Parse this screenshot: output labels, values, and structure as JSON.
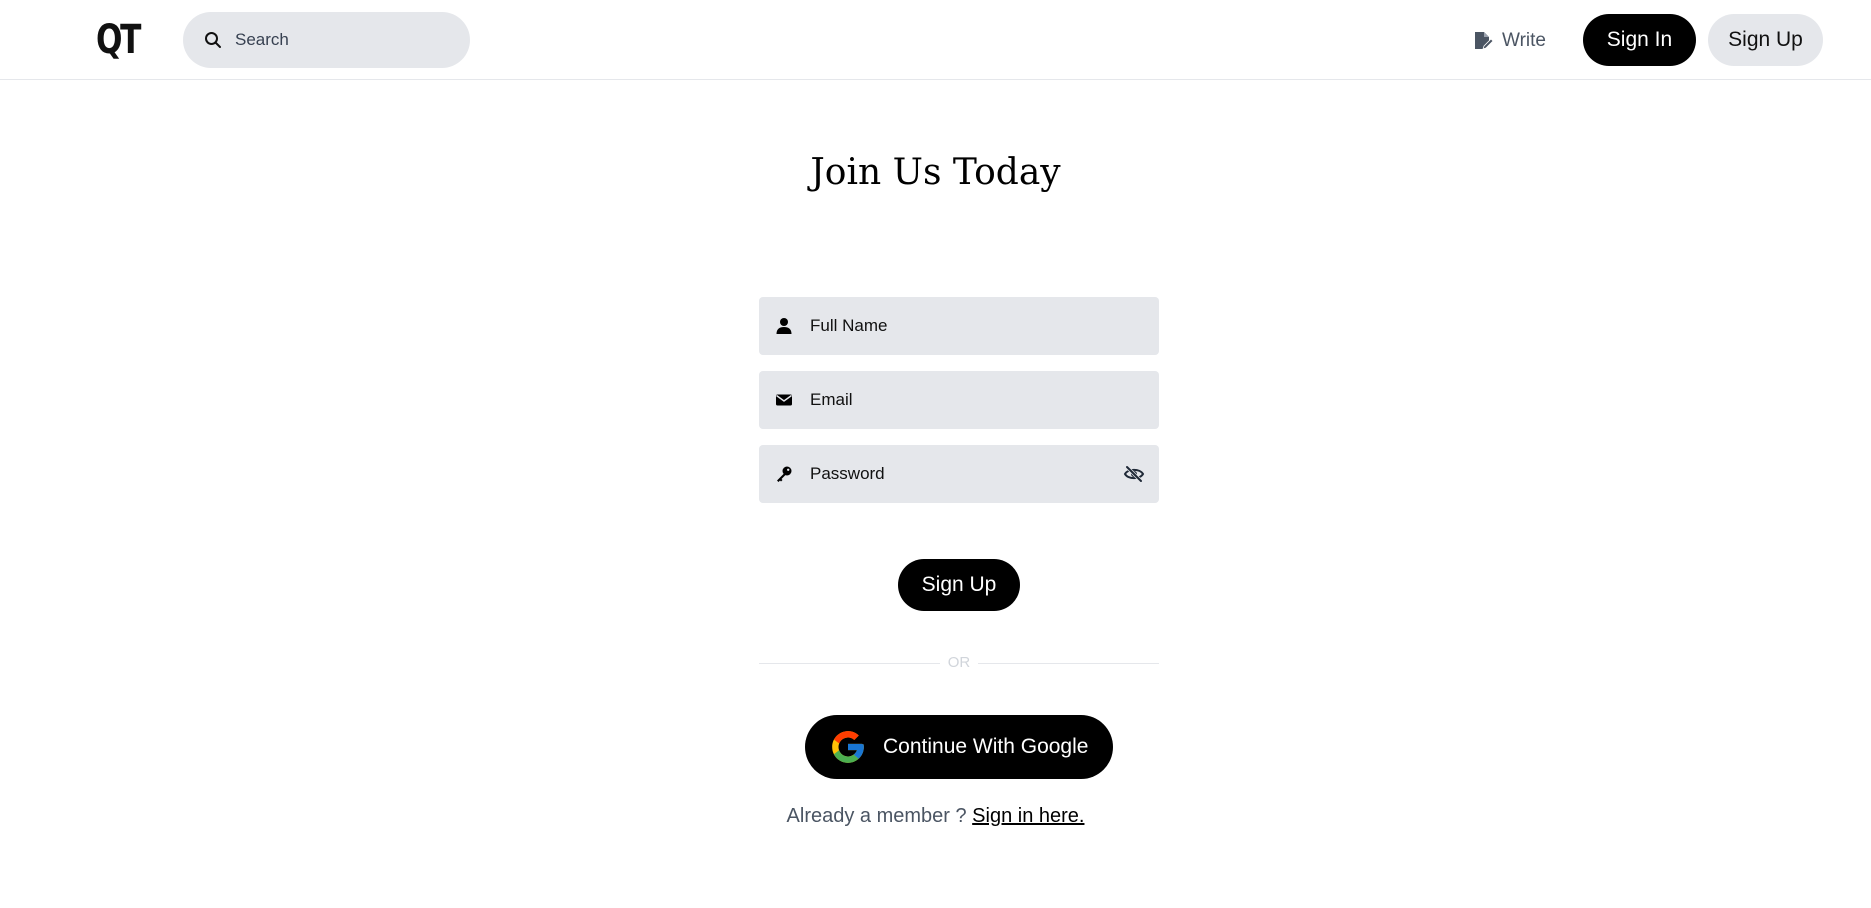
{
  "header": {
    "logo": "QT",
    "search_placeholder": "Search",
    "write_label": "Write",
    "sign_in_label": "Sign In",
    "sign_up_label": "Sign Up"
  },
  "form": {
    "title": "Join Us Today",
    "full_name_placeholder": "Full Name",
    "email_placeholder": "Email",
    "password_placeholder": "Password",
    "submit_label": "Sign Up",
    "divider_text": "OR",
    "google_label": "Continue With Google",
    "member_prompt": "Already a member ?",
    "sign_in_link": "Sign in here."
  },
  "icons": {
    "search": "search-icon",
    "write": "edit-document-icon",
    "full_name": "user-icon",
    "email": "envelope-icon",
    "password": "key-icon",
    "toggle_password": "eye-slash-icon",
    "google": "google-logo-icon"
  },
  "colors": {
    "primary": "#000000",
    "input_bg": "#e5e7eb",
    "muted_text": "#4b5563",
    "divider": "#e5e7eb"
  }
}
